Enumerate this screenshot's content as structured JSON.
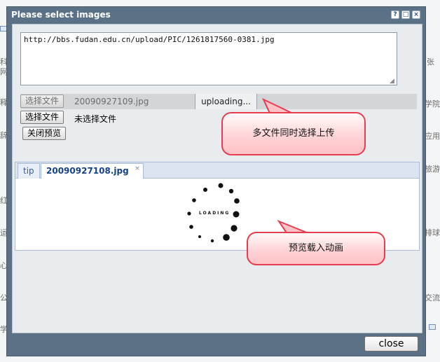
{
  "background": {
    "fragments": [
      {
        "text": "科",
        "side": "left"
      },
      {
        "text": "网",
        "side": "left"
      },
      {
        "text": "释",
        "side": "left"
      },
      {
        "text": "辞",
        "side": "left"
      },
      {
        "text": "红",
        "side": "left"
      },
      {
        "text": "运",
        "side": "left"
      },
      {
        "text": "心",
        "side": "left"
      },
      {
        "text": "公",
        "side": "left"
      },
      {
        "text": "学",
        "side": "left"
      },
      {
        "text": "张",
        "side": "right"
      },
      {
        "text": "学院",
        "side": "right"
      },
      {
        "text": "应用",
        "side": "right"
      },
      {
        "text": "旅游",
        "side": "right"
      },
      {
        "text": "排球",
        "side": "right"
      },
      {
        "text": "交流",
        "side": "right"
      }
    ]
  },
  "dialog": {
    "title": "Please select images",
    "title_buttons": [
      {
        "name": "help",
        "glyph": "?"
      },
      {
        "name": "maximize",
        "glyph": "□"
      },
      {
        "name": "close",
        "glyph": "×"
      }
    ],
    "url_text": "http://bbs.fudan.edu.cn/upload/PIC/1261817560-0381.jpg",
    "upload": {
      "choose_button_label": "选择文件",
      "uploading_filename": "20090927109.jpg",
      "status_text": "uploading...",
      "second_choose_label": "选择文件",
      "no_file_text": "未选择文件",
      "close_preview_label": "关闭预览"
    },
    "tabs": [
      {
        "label": "tip",
        "active": false
      },
      {
        "label": "20090927108.jpg",
        "active": true,
        "close_glyph": "×"
      }
    ],
    "preview": {
      "loading_text": "LOADING"
    },
    "close_label": "close"
  },
  "annotations": {
    "multi_upload": "多文件同时选择上传",
    "preview_anim": "预览载入动画"
  },
  "colors": {
    "dialog_frame": "#5b7186",
    "content_bg": "#e9ecef",
    "tab_text": "#15428b",
    "callout_border": "#e83c50",
    "callout_fill": "#ffc3c7"
  }
}
